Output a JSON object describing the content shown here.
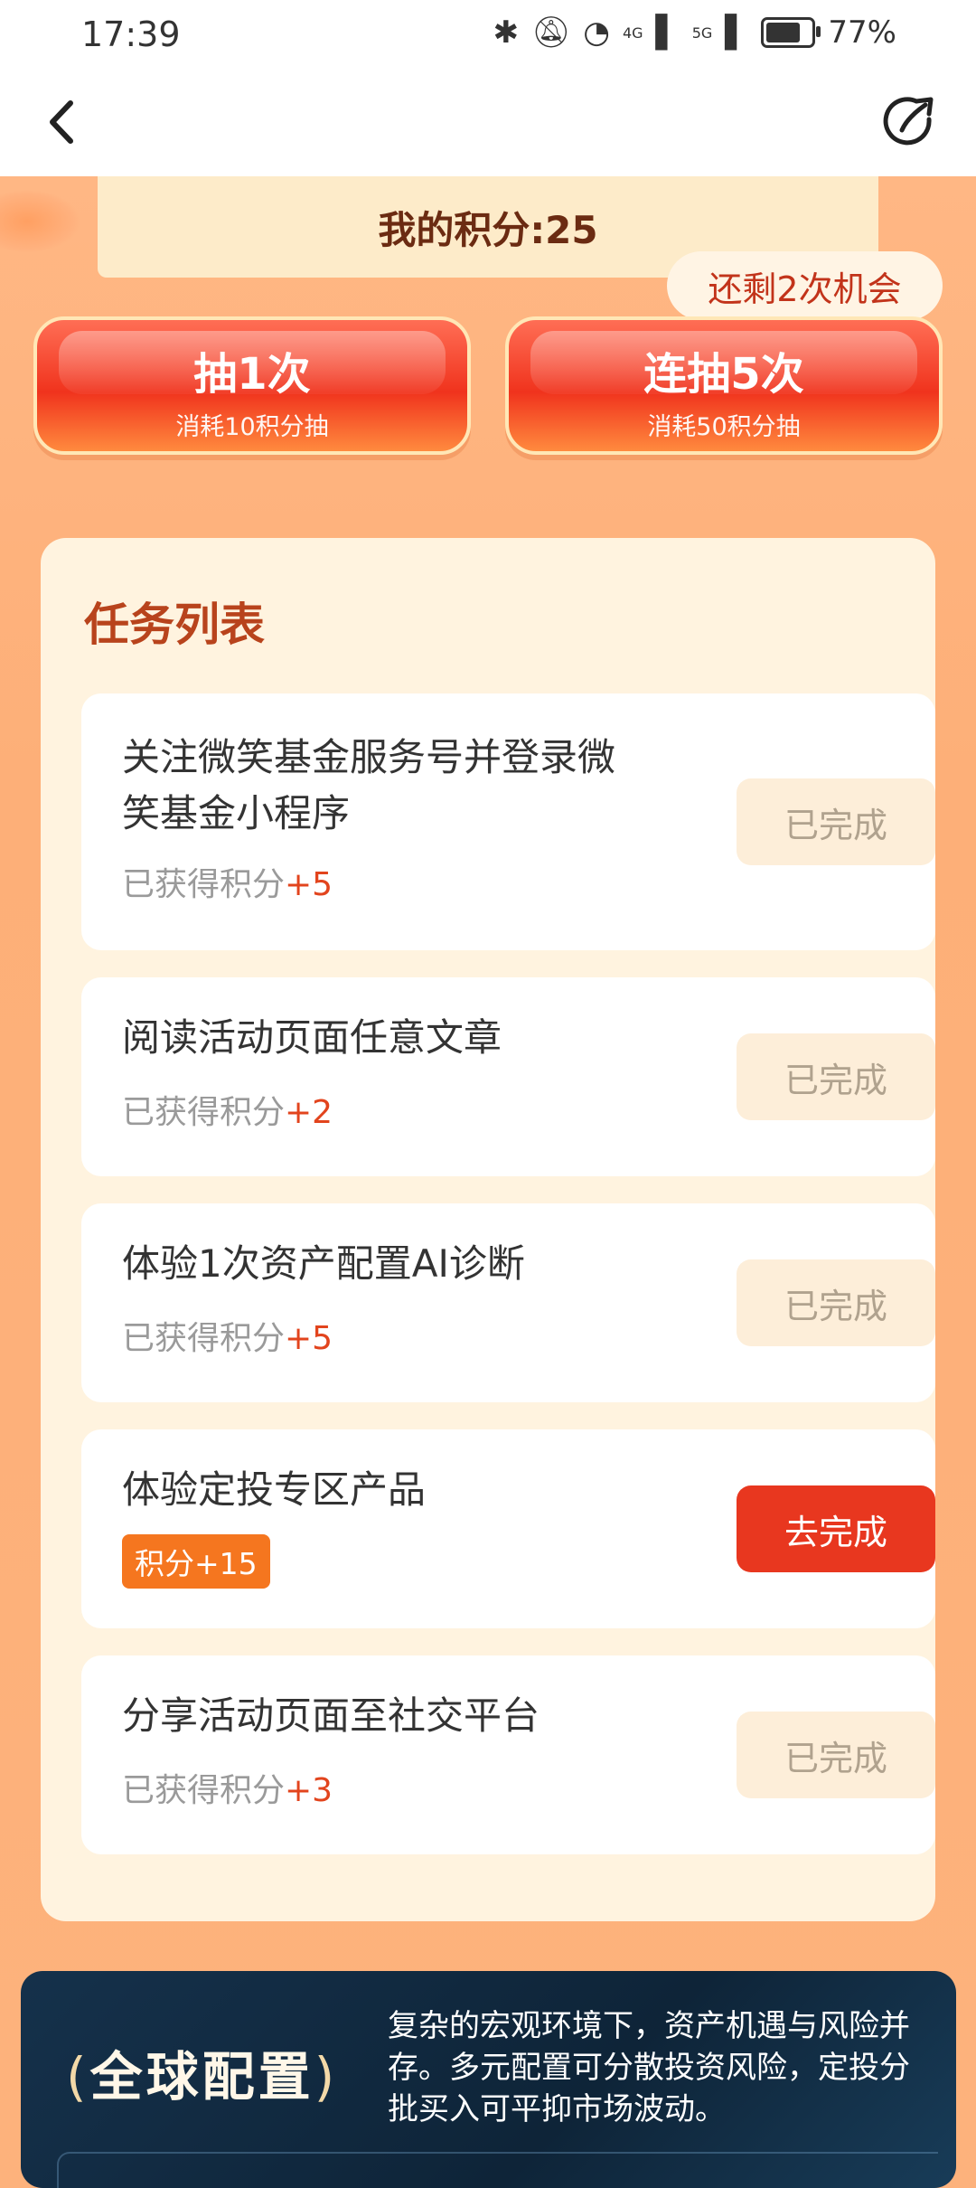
{
  "status_bar": {
    "time": "17:39",
    "net1": "4G",
    "net2": "5G",
    "battery": "77%",
    "battery_level": 0.77
  },
  "nav": {
    "back_icon": "chevron-left-icon",
    "share_icon": "share-icon"
  },
  "points": {
    "label": "我的积分:25"
  },
  "chance": {
    "label": "还剩2次机会"
  },
  "draw": {
    "single": {
      "title": "抽1次",
      "cost": "消耗10积分抽"
    },
    "five": {
      "title": "连抽5次",
      "cost": "消耗50积分抽"
    }
  },
  "tasks": {
    "title": "任务列表",
    "items": [
      {
        "name_line1": "关注微笑基金服务号并登录微",
        "name_line2": "笑基金小程序",
        "earned_prefix": "已获得积分",
        "earned_points": "+5",
        "button": "已完成",
        "status": "done"
      },
      {
        "name_line1": "阅读活动页面任意文章",
        "earned_prefix": "已获得积分",
        "earned_points": "+2",
        "button": "已完成",
        "status": "done"
      },
      {
        "name_line1": "体验1次资产配置AI诊断",
        "earned_prefix": "已获得积分",
        "earned_points": "+5",
        "button": "已完成",
        "status": "done"
      },
      {
        "name_line1": "体验定投专区产品",
        "tag": "积分+15",
        "button": "去完成",
        "status": "todo"
      },
      {
        "name_line1": "分享活动页面至社交平台",
        "earned_prefix": "已获得积分",
        "earned_points": "+3",
        "button": "已完成",
        "status": "done"
      }
    ]
  },
  "banner": {
    "brand": "全球配置",
    "description": "复杂的宏观环境下，资产机遇与风险并存。多元配置可分散投资风险，定投分批买入可平抑市场波动。"
  }
}
